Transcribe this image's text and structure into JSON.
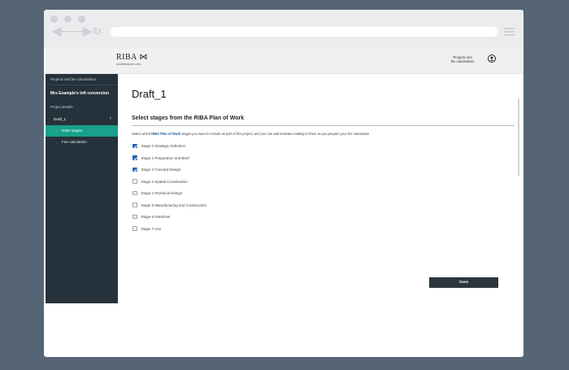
{
  "browser": {
    "icons": [
      "back-arrow-icon",
      "forward-arrow-icon",
      "reload-icon",
      "hamburger-menu-icon"
    ]
  },
  "header": {
    "logo": "RIBA",
    "logo_sub": "Architecture.com",
    "link_line1": "Projects and",
    "link_line2": "fee calculations"
  },
  "sidebar": {
    "top_link": "Projects and fee calculations",
    "project_name": "Mrs Example's loft conversion",
    "details_label": "Project details",
    "draft_label": "Draft_1",
    "items": [
      {
        "label": "RIBA stages",
        "active": true
      },
      {
        "label": "Fee calculation",
        "active": false
      }
    ],
    "active_color": "#18a08a"
  },
  "main": {
    "title": "Draft_1",
    "section_title": "Select stages from the RIBA Plan of Work",
    "intro_before": "Select which ",
    "intro_link": "RIBA Plan of Work",
    "intro_after": " stages you want to include as part of this project, and you can add activities relating to them as you prepare your fee calculation.",
    "stages": [
      {
        "label": "Stage 0 Strategic Definition",
        "checked": true
      },
      {
        "label": "Stage 1 Preparation and Brief",
        "checked": true
      },
      {
        "label": "Stage 2 Concept Design",
        "checked": true
      },
      {
        "label": "Stage 3 Spatial Coordination",
        "checked": false
      },
      {
        "label": "Stage 4 Technical Design",
        "checked": false
      },
      {
        "label": "Stage 5 Manufacturing and Construction",
        "checked": false
      },
      {
        "label": "Stage 6 Handover",
        "checked": false
      },
      {
        "label": "Stage 7 Use",
        "checked": false
      }
    ],
    "save_label": "Save"
  }
}
